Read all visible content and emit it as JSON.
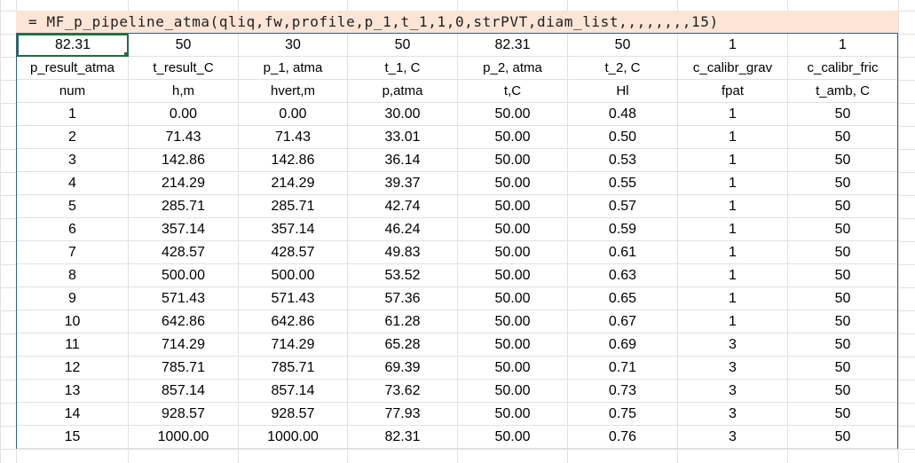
{
  "formula": "= MF_p_pipeline_atma(qliq,fw,profile,p_1,t_1,1,0,strPVT,diam_list,,,,,,,,15)",
  "top_values": [
    "82.31",
    "50",
    "30",
    "50",
    "82.31",
    "50",
    "1",
    "1"
  ],
  "headers": [
    "p_result_atma",
    "t_result_C",
    "p_1, atma",
    "t_1, C",
    "p_2, atma",
    "t_2, C",
    "c_calibr_grav",
    "c_calibr_fric"
  ],
  "units": [
    "num",
    "h,m",
    "hvert,m",
    "p,atma",
    "t,C",
    "Hl",
    "fpat",
    "t_amb, C"
  ],
  "rows": [
    [
      "1",
      "0.00",
      "0.00",
      "30.00",
      "50.00",
      "0.48",
      "1",
      "50"
    ],
    [
      "2",
      "71.43",
      "71.43",
      "33.01",
      "50.00",
      "0.50",
      "1",
      "50"
    ],
    [
      "3",
      "142.86",
      "142.86",
      "36.14",
      "50.00",
      "0.53",
      "1",
      "50"
    ],
    [
      "4",
      "214.29",
      "214.29",
      "39.37",
      "50.00",
      "0.55",
      "1",
      "50"
    ],
    [
      "5",
      "285.71",
      "285.71",
      "42.74",
      "50.00",
      "0.57",
      "1",
      "50"
    ],
    [
      "6",
      "357.14",
      "357.14",
      "46.24",
      "50.00",
      "0.59",
      "1",
      "50"
    ],
    [
      "7",
      "428.57",
      "428.57",
      "49.83",
      "50.00",
      "0.61",
      "1",
      "50"
    ],
    [
      "8",
      "500.00",
      "500.00",
      "53.52",
      "50.00",
      "0.63",
      "1",
      "50"
    ],
    [
      "9",
      "571.43",
      "571.43",
      "57.36",
      "50.00",
      "0.65",
      "1",
      "50"
    ],
    [
      "10",
      "642.86",
      "642.86",
      "61.28",
      "50.00",
      "0.67",
      "1",
      "50"
    ],
    [
      "11",
      "714.29",
      "714.29",
      "65.28",
      "50.00",
      "0.69",
      "3",
      "50"
    ],
    [
      "12",
      "785.71",
      "785.71",
      "69.39",
      "50.00",
      "0.71",
      "3",
      "50"
    ],
    [
      "13",
      "857.14",
      "857.14",
      "73.62",
      "50.00",
      "0.73",
      "3",
      "50"
    ],
    [
      "14",
      "928.57",
      "928.57",
      "77.93",
      "50.00",
      "0.75",
      "3",
      "50"
    ],
    [
      "15",
      "1000.00",
      "1000.00",
      "82.31",
      "50.00",
      "0.76",
      "3",
      "50"
    ]
  ]
}
